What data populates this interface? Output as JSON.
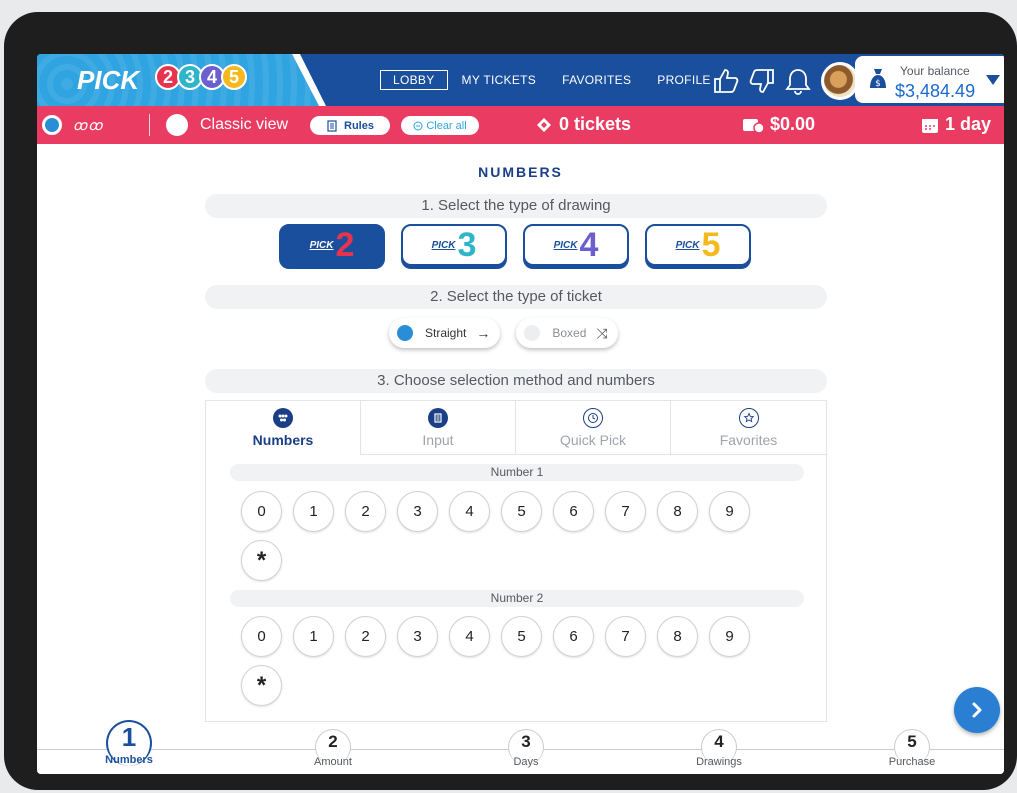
{
  "brand": {
    "logo_text": "PICK",
    "logo_digits": [
      "2",
      "3",
      "4",
      "5"
    ],
    "colors": {
      "primary": "#1a4f9e",
      "accent": "#2fa4e0",
      "pink": "#ea3c63"
    }
  },
  "nav": {
    "lobby": "LOBBY",
    "my_tickets": "MY TICKETS",
    "favorites": "FAVORITES",
    "profile": "PROFILE"
  },
  "balance": {
    "label": "Your balance",
    "value": "$3,484.49"
  },
  "toolbar": {
    "loto_label": "ꝏꝏ",
    "classic_view": "Classic view",
    "rules": "Rules",
    "clear_all": "Clear all",
    "tickets": "0 tickets",
    "total": "$0.00",
    "days": "1 day"
  },
  "main": {
    "title": "NUMBERS",
    "step1": "1. Select the type of drawing",
    "picks": [
      {
        "small": "PICK",
        "num": "2",
        "color": "#e8334f"
      },
      {
        "small": "PICK",
        "num": "3",
        "color": "#2fb5c9"
      },
      {
        "small": "PICK",
        "num": "4",
        "color": "#6b5fd0"
      },
      {
        "small": "PICK",
        "num": "5",
        "color": "#f5b91e"
      }
    ],
    "step2": "2. Select the type of ticket",
    "ticket_types": [
      {
        "label": "Straight",
        "icon": "→"
      },
      {
        "label": "Boxed",
        "icon": "⤨"
      }
    ],
    "step3": "3. Choose selection method and numbers",
    "tabs": [
      {
        "label": "Numbers"
      },
      {
        "label": "Input"
      },
      {
        "label": "Quick Pick"
      },
      {
        "label": "Favorites"
      }
    ],
    "number_groups": [
      {
        "label": "Number 1",
        "digits": [
          "0",
          "1",
          "2",
          "3",
          "4",
          "5",
          "6",
          "7",
          "8",
          "9",
          "*"
        ]
      },
      {
        "label": "Number 2",
        "digits": [
          "0",
          "1",
          "2",
          "3",
          "4",
          "5",
          "6",
          "7",
          "8",
          "9",
          "*"
        ]
      }
    ]
  },
  "steps": [
    {
      "num": "1",
      "label": "Numbers"
    },
    {
      "num": "2",
      "label": "Amount"
    },
    {
      "num": "3",
      "label": "Days"
    },
    {
      "num": "4",
      "label": "Drawings"
    },
    {
      "num": "5",
      "label": "Purchase"
    }
  ]
}
